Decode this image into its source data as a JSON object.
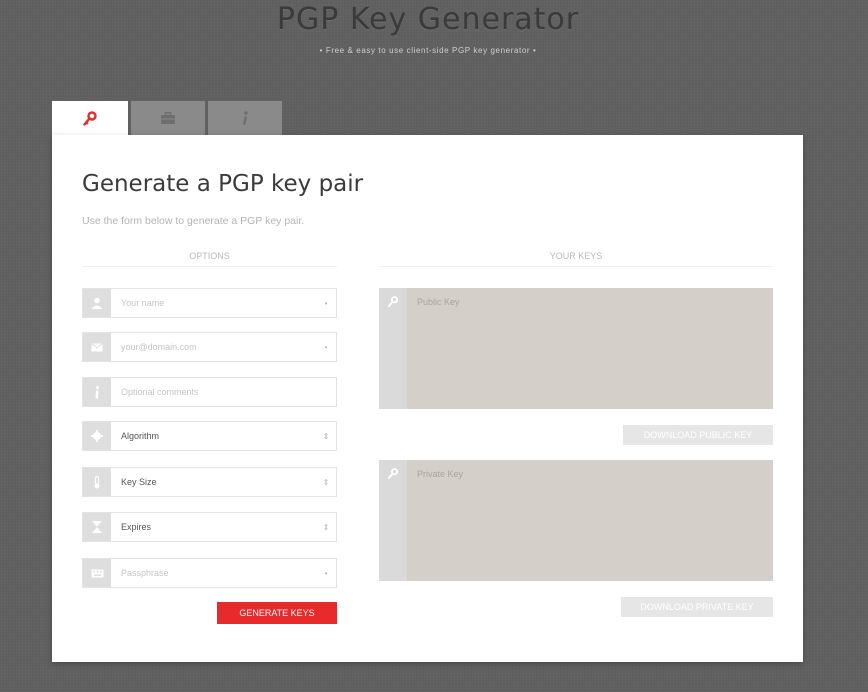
{
  "site": {
    "title": "PGP Key Generator",
    "subtitle": "•  Free & easy to use client-side PGP key generator  •"
  },
  "tabs": [
    {
      "icon": "key-icon",
      "active": true
    },
    {
      "icon": "briefcase-icon",
      "active": false
    },
    {
      "icon": "info-icon",
      "active": false
    }
  ],
  "panel": {
    "heading": "Generate a PGP key pair",
    "intro": "Use the form below to generate a PGP key pair."
  },
  "options": {
    "header": "OPTIONS",
    "name": {
      "placeholder": "Your name",
      "required_mark": "•",
      "icon": "user-icon"
    },
    "email": {
      "placeholder": "your@domain.com",
      "required_mark": "•",
      "icon": "envelope-icon"
    },
    "comments": {
      "placeholder": "Optional comments",
      "icon": "info-icon"
    },
    "algorithm": {
      "label": "Algorithm",
      "icon": "gear-icon"
    },
    "key_size": {
      "label": "Key Size",
      "icon": "thermometer-icon"
    },
    "expires": {
      "label": "Expires",
      "icon": "hourglass-icon"
    },
    "passphrase": {
      "placeholder": "Passphrase",
      "required_mark": "•",
      "icon": "keyboard-icon"
    },
    "select_arrow": "⇕",
    "generate_label": "GENERATE KEYS"
  },
  "keys": {
    "header": "YOUR KEYS",
    "public_placeholder": "Public Key",
    "private_placeholder": "Private Key",
    "download_public": "DOWNLOAD PUBLIC KEY",
    "download_private": "DOWNLOAD PRIVATE KEY"
  },
  "colors": {
    "accent": "#e82a2a",
    "background": "#5f5f5f",
    "key_area": "#d4d0c9"
  }
}
